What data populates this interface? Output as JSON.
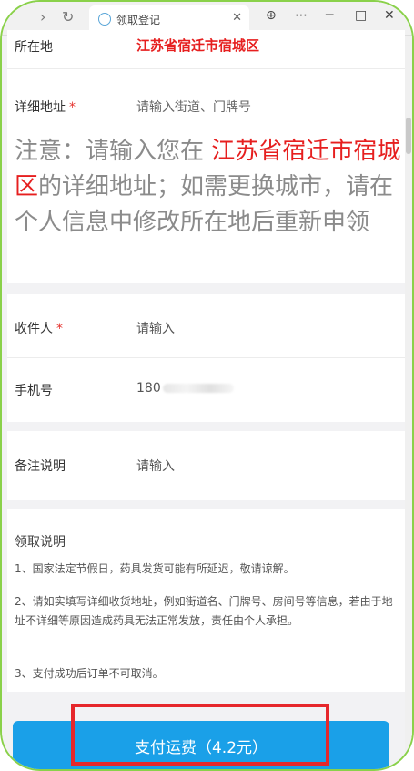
{
  "browser": {
    "back_icon": "chevron-right-icon",
    "refresh_icon": "refresh-icon",
    "tab_title": "领取登记",
    "tab_close": "✕",
    "controls": [
      "⊕",
      "⋯",
      "─",
      "□",
      "✕"
    ]
  },
  "form": {
    "location_label": "所在地",
    "location_value": "江苏省宿迁市宿城区",
    "address_label": "详细地址",
    "address_required": "*",
    "address_placeholder": "请输入街道、门牌号",
    "notice_prefix": "注意：请输入您在 ",
    "notice_region": "江苏省宿迁市宿城区",
    "notice_suffix": "的详细地址；如需更换城市，请在个人信息中修改所在地后重新申领",
    "recipient_label": "收件人",
    "recipient_required": "*",
    "recipient_placeholder": "请输入",
    "phone_label": "手机号",
    "phone_value": "180",
    "remark_label": "备注说明",
    "remark_placeholder": "请输入"
  },
  "instructions": {
    "title": "领取说明",
    "items": [
      "1、国家法定节假日，药具发货可能有所延迟，敬请谅解。",
      "2、请如实填写详细收货地址，例如街道名、门牌号、房间号等信息，若由于地址不详细等原因造成药具无法正常发放，责任由个人承担。",
      "3、支付成功后订单不可取消。"
    ]
  },
  "pay_button": {
    "label": "支付运费（4.2元）"
  },
  "colors": {
    "accent_button": "#1aa0e8",
    "highlight_red": "#e61f1f",
    "frame_green": "#8ad14a"
  }
}
